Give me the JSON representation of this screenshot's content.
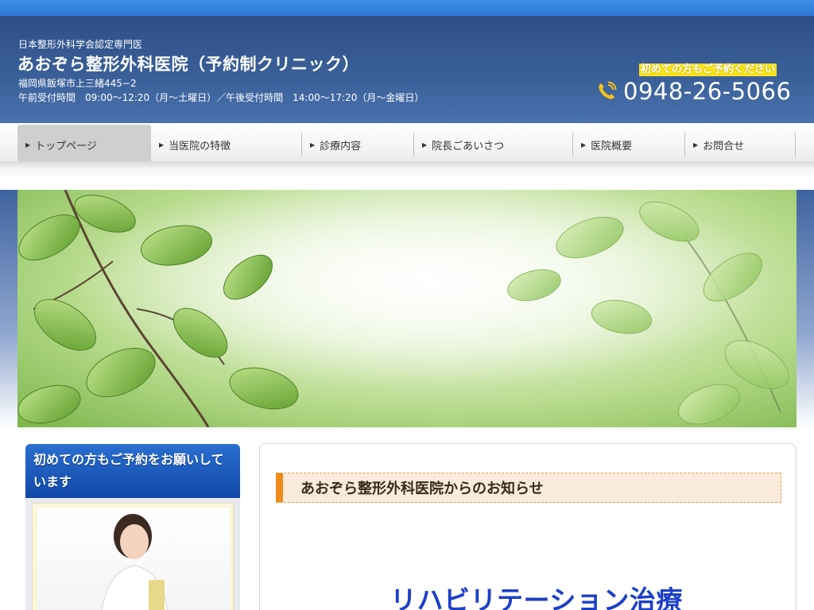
{
  "header": {
    "certification": "日本整形外科学会認定専門医",
    "clinic_name": "あおぞら整形外科医院（予約制クリニック）",
    "address": "福岡県飯塚市上三緒445−2",
    "hours": "午前受付時間　09:00〜12:20（月〜土曜日）／午後受付時間　14:00〜17:20（月〜金曜日）",
    "notice": "初めての方もご予約ください",
    "phone": "0948-26-5066",
    "phone_icon": "phone-icon"
  },
  "nav": {
    "items": [
      {
        "label": "トップページ",
        "active": true
      },
      {
        "label": "当医院の特徴",
        "active": false
      },
      {
        "label": "診療内容",
        "active": false
      },
      {
        "label": "院長ごあいさつ",
        "active": false
      },
      {
        "label": "医院概要",
        "active": false
      },
      {
        "label": "お問合せ",
        "active": false
      }
    ]
  },
  "sidebar": {
    "heading": "初めての方もご予約をお願いしています"
  },
  "main": {
    "news_heading": "あおぞら整形外科医院からのお知らせ",
    "big_title": "リハビリテーション治療"
  },
  "colors": {
    "header_bg": "#3a5f98",
    "topbar": "#3585e0",
    "notice_bg": "#f7e31a",
    "news_accent": "#f08a1c",
    "big_title": "#1d3fc8",
    "sidebar_head": "#1a5bbf"
  }
}
